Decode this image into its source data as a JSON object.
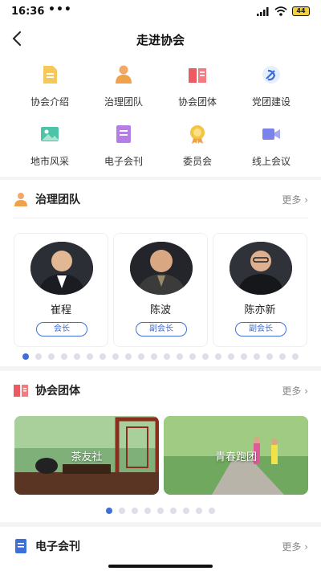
{
  "status": {
    "time": "16:36",
    "dots": "•••",
    "battery": "44"
  },
  "nav": {
    "title": "走进协会"
  },
  "menu": [
    {
      "label": "协会介绍",
      "icon": "document-icon"
    },
    {
      "label": "治理团队",
      "icon": "person-icon"
    },
    {
      "label": "协会团体",
      "icon": "book-icon"
    },
    {
      "label": "党团建设",
      "icon": "party-emblem-icon"
    },
    {
      "label": "地市风采",
      "icon": "picture-icon"
    },
    {
      "label": "电子会刊",
      "icon": "magazine-icon"
    },
    {
      "label": "委员会",
      "icon": "medal-icon"
    },
    {
      "label": "线上会议",
      "icon": "video-call-icon"
    }
  ],
  "team": {
    "title": "治理团队",
    "more": "更多",
    "members": [
      {
        "name": "崔程",
        "role": "会长"
      },
      {
        "name": "陈波",
        "role": "副会长"
      },
      {
        "name": "陈亦新",
        "role": "副会长"
      }
    ],
    "pages": 22
  },
  "groups": {
    "title": "协会团体",
    "more": "更多",
    "banners": [
      {
        "caption": "茶友社"
      },
      {
        "caption": "青春跑团"
      }
    ],
    "pages": 9
  },
  "magazine": {
    "title": "电子会刊",
    "more": "更多"
  },
  "colors": {
    "accent": "#3e6fd8",
    "orange": "#f0a24a",
    "red": "#ec5a62"
  }
}
